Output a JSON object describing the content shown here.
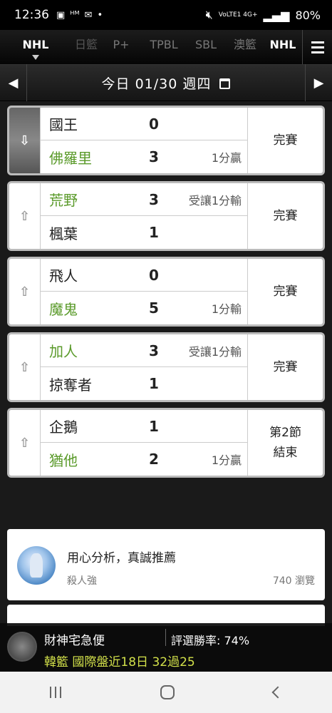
{
  "status_bar": {
    "time": "12:36",
    "signal_text": "VoLTE1 4G+",
    "battery": "80%"
  },
  "sport_tabs": [
    {
      "label": "NHL",
      "active": true
    },
    {
      "label": "日籃",
      "active": false
    },
    {
      "label": "P+",
      "active": false
    },
    {
      "label": "TPBL",
      "active": false
    },
    {
      "label": "SBL",
      "active": false
    },
    {
      "label": "澳籃",
      "active": false
    },
    {
      "label": "NHL",
      "active": false
    }
  ],
  "date_bar": {
    "date_text": "今日 01/30 週四"
  },
  "games": [
    {
      "rows": [
        {
          "team": "國王",
          "score": "0",
          "note": "",
          "winner": false
        },
        {
          "team": "佛羅里",
          "score": "3",
          "note": "1分贏",
          "winner": true
        }
      ],
      "status": "完賽",
      "expanded": true
    },
    {
      "rows": [
        {
          "team": "荒野",
          "score": "3",
          "note": "受讓1分輸",
          "winner": true
        },
        {
          "team": "楓葉",
          "score": "1",
          "note": "",
          "winner": false
        }
      ],
      "status": "完賽",
      "expanded": false
    },
    {
      "rows": [
        {
          "team": "飛人",
          "score": "0",
          "note": "",
          "winner": false
        },
        {
          "team": "魔鬼",
          "score": "5",
          "note": "1分輸",
          "winner": true
        }
      ],
      "status": "完賽",
      "expanded": false
    },
    {
      "rows": [
        {
          "team": "加人",
          "score": "3",
          "note": "受讓1分輸",
          "winner": true
        },
        {
          "team": "掠奪者",
          "score": "1",
          "note": "",
          "winner": false
        }
      ],
      "status": "完賽",
      "expanded": false
    },
    {
      "rows": [
        {
          "team": "企鵝",
          "score": "1",
          "note": "",
          "winner": false
        },
        {
          "team": "猶他",
          "score": "2",
          "note": "1分贏",
          "winner": true
        }
      ],
      "status_line1": "第2節",
      "status_line2": "結束",
      "expanded": false
    }
  ],
  "article": {
    "title": "用心分析，真誠推薦",
    "author": "殺人強",
    "views": "740 瀏覽"
  },
  "promo": {
    "name": "財神宅急便",
    "rate": "評選勝率: 74%",
    "record": "韓籃 國際盤近18日 32過25"
  },
  "colors": {
    "winner_green": "#5a9a2a",
    "promo_yellow": "#d2e04a"
  }
}
